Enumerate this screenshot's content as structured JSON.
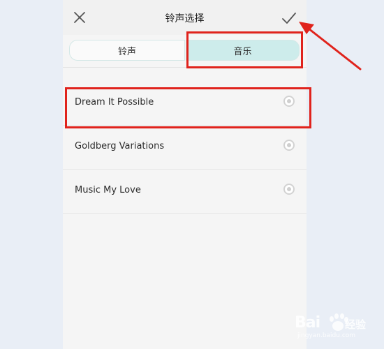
{
  "header": {
    "title": "铃声选择",
    "close_icon": "close-icon",
    "confirm_icon": "check-icon"
  },
  "tabs": [
    {
      "label": "铃声",
      "selected": false
    },
    {
      "label": "音乐",
      "selected": true
    }
  ],
  "songs": [
    {
      "title": "Dream It Possible"
    },
    {
      "title": "Goldberg Variations"
    },
    {
      "title": "Music My Love"
    }
  ],
  "colors": {
    "accent_tab": "#cdeceb",
    "annotation_red": "#e0231c",
    "background": "#f5f5f5"
  },
  "watermark": {
    "brand": "Bai",
    "brand_cn": "经验",
    "sub": "jingyan.baidu.com"
  }
}
